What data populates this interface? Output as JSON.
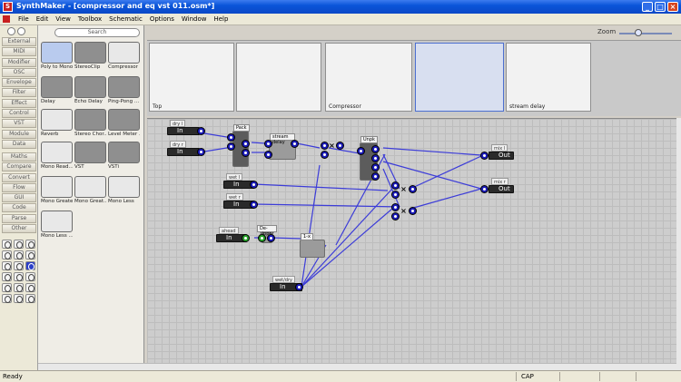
{
  "window": {
    "title": "SynthMaker - [compressor and eq vst 011.osm*]"
  },
  "menu": [
    "File",
    "Edit",
    "View",
    "Toolbox",
    "Schematic",
    "Options",
    "Window",
    "Help"
  ],
  "categories": [
    "External",
    "MIDI",
    "Modifier",
    "OSC",
    "Envelope",
    "Filter",
    "Effect",
    "Control",
    "VST",
    "Module",
    "Data",
    "Maths",
    "Compare",
    "Convert",
    "Flow",
    "GUI",
    "Code",
    "Parse",
    "Other"
  ],
  "search": {
    "placeholder": "Search"
  },
  "modules": [
    "Poly to Mono",
    "StereoClip",
    "Compressor ...",
    "Delay",
    "Echo Delay",
    "Ping-Pong ...",
    "Reverb",
    "Stereo Chor...",
    "Level Meter ...",
    "Mono Read...",
    "VST",
    "VSTi",
    "Mono Greater",
    "Mono Great...",
    "Mono Less",
    "Mono Less ..."
  ],
  "zoom": {
    "label": "Zoom"
  },
  "navigator": [
    "Top",
    "",
    "Compressor",
    "",
    "stream delay"
  ],
  "schematic": {
    "inputs": [
      {
        "tag": "dry l",
        "label": "In"
      },
      {
        "tag": "dry r",
        "label": "In"
      },
      {
        "tag": "wet l",
        "label": "In"
      },
      {
        "tag": "wet r",
        "label": "In"
      },
      {
        "tag": "ahead",
        "label": "In"
      },
      {
        "tag": "wet/dry",
        "label": "In"
      }
    ],
    "outputs": [
      {
        "tag": "mix l",
        "label": "Out"
      },
      {
        "tag": "mix r",
        "label": "Out"
      }
    ],
    "blocks": {
      "pack": "Pack",
      "stream_delay": "stream delay",
      "delay": "delay",
      "unpack": "Unpk",
      "de_zipper": "De-zipper",
      "one_minus": "1-x"
    },
    "multiply": "×"
  },
  "status": {
    "ready": "Ready",
    "cap": "CAP"
  }
}
